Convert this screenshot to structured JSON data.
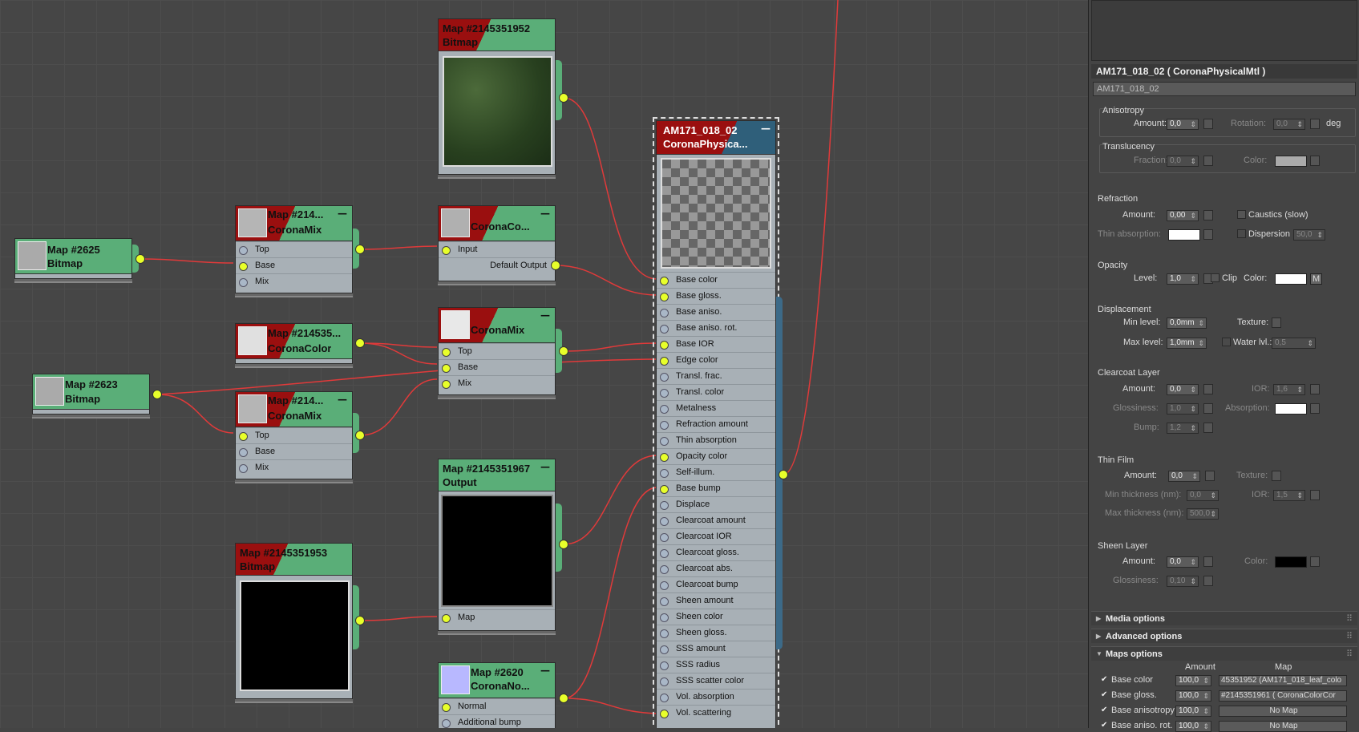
{
  "nodes": {
    "bitmap_top": {
      "title1": "Map #2145351952",
      "title2": "Bitmap"
    },
    "coronamix_a": {
      "title1": "Map #214...",
      "title2": "CoronaMix",
      "ports": [
        "Top",
        "Base",
        "Mix"
      ]
    },
    "bitmap_2625": {
      "title1": "Map #2625",
      "title2": "Bitmap"
    },
    "coronacolor_a": {
      "title2": "CoronaCo...",
      "ports": [
        "Input"
      ],
      "out": "Default Output"
    },
    "coronacolor_b": {
      "title1": "Map #214535...",
      "title2": "CoronaColor"
    },
    "coronamix_b": {
      "title2": "CoronaMix",
      "ports": [
        "Top",
        "Base",
        "Mix"
      ]
    },
    "bitmap_2623": {
      "title1": "Map #2623",
      "title2": "Bitmap"
    },
    "coronamix_c": {
      "title1": "Map #214...",
      "title2": "CoronaMix",
      "ports": [
        "Top",
        "Base",
        "Mix"
      ]
    },
    "output": {
      "title1": "Map #2145351967",
      "title2": "Output",
      "ports": [
        "Map"
      ]
    },
    "bitmap_mask": {
      "title1": "Map #2145351953",
      "title2": "Bitmap"
    },
    "normal": {
      "title1": "Map #2620",
      "title2": "CoronaNo...",
      "ports": [
        "Normal",
        "Additional bump"
      ]
    },
    "material": {
      "title1": "AM171_018_02",
      "title2": "CoronaPhysica...",
      "ports": [
        "Base color",
        "Base gloss.",
        "Base aniso.",
        "Base aniso. rot.",
        "Base IOR",
        "Edge color",
        "Transl. frac.",
        "Transl. color",
        "Metalness",
        "Refraction amount",
        "Thin absorption",
        "Opacity color",
        "Self-illum.",
        "Base bump",
        "Displace",
        "Clearcoat amount",
        "Clearcoat IOR",
        "Clearcoat gloss.",
        "Clearcoat abs.",
        "Clearcoat bump",
        "Sheen amount",
        "Sheen color",
        "Sheen gloss.",
        "SSS amount",
        "SSS radius",
        "SSS scatter color",
        "Vol. absorption",
        "Vol. scattering"
      ]
    }
  },
  "panel": {
    "title": "AM171_018_02  ( CoronaPhysicalMtl )",
    "name": "AM171_018_02",
    "anisotropy": {
      "label": "Anisotropy",
      "amount_label": "Amount:",
      "amount": "0,0",
      "rotation_label": "Rotation:",
      "rotation": "0,0",
      "unit": "deg"
    },
    "translucency": {
      "label": "Translucency",
      "fraction_label": "Fraction:",
      "fraction": "0,0",
      "color_label": "Color:"
    },
    "refraction": {
      "label": "Refraction",
      "amount_label": "Amount:",
      "amount": "0,00",
      "caustics": "Caustics (slow)",
      "thin_label": "Thin absorption:",
      "dispersion": "Dispersion",
      "dispersion_val": "50,0"
    },
    "opacity": {
      "label": "Opacity",
      "level_label": "Level:",
      "level": "1,0",
      "clip": "Clip",
      "color_label": "Color:",
      "m": "M"
    },
    "displacement": {
      "label": "Displacement",
      "min_label": "Min level:",
      "min": "0,0mm",
      "texture_label": "Texture:",
      "max_label": "Max level:",
      "max": "1,0mm",
      "water": "Water lvl.:",
      "water_val": "0,5"
    },
    "clearcoat": {
      "label": "Clearcoat Layer",
      "amount_label": "Amount:",
      "amount": "0,0",
      "ior_label": "IOR:",
      "ior": "1,6",
      "gloss_label": "Glossiness:",
      "gloss": "1,0",
      "abs_label": "Absorption:",
      "bump_label": "Bump:",
      "bump": "1,2"
    },
    "thinfilm": {
      "label": "Thin Film",
      "amount_label": "Amount:",
      "amount": "0,0",
      "texture_label": "Texture:",
      "min_label": "Min thickness (nm):",
      "min": "0,0",
      "ior_label": "IOR:",
      "ior": "1,5",
      "max_label": "Max thickness (nm):",
      "max": "500,0"
    },
    "sheen": {
      "label": "Sheen Layer",
      "amount_label": "Amount:",
      "amount": "0,0",
      "color_label": "Color:",
      "gloss_label": "Glossiness:",
      "gloss": "0,10"
    },
    "rollouts": [
      "Media options",
      "Advanced options",
      "Maps options"
    ],
    "maps": {
      "amount_header": "Amount",
      "map_header": "Map",
      "rows": [
        {
          "label": "Base color",
          "amount": "100,0",
          "map": "45351952 (AM171_018_leaf_colo"
        },
        {
          "label": "Base gloss.",
          "amount": "100,0",
          "map": "#2145351961  ( CoronaColorCor"
        },
        {
          "label": "Base anisotropy",
          "amount": "100,0",
          "map": "No Map"
        },
        {
          "label": "Base aniso. rot.",
          "amount": "100,0",
          "map": "No Map"
        }
      ]
    }
  },
  "colors": {
    "header": "#5aae78",
    "node_body": "#a8b0b6",
    "material_header": "#2f5f7a",
    "wire": "#e03a3a",
    "socket_on": "#e8ff2a"
  }
}
